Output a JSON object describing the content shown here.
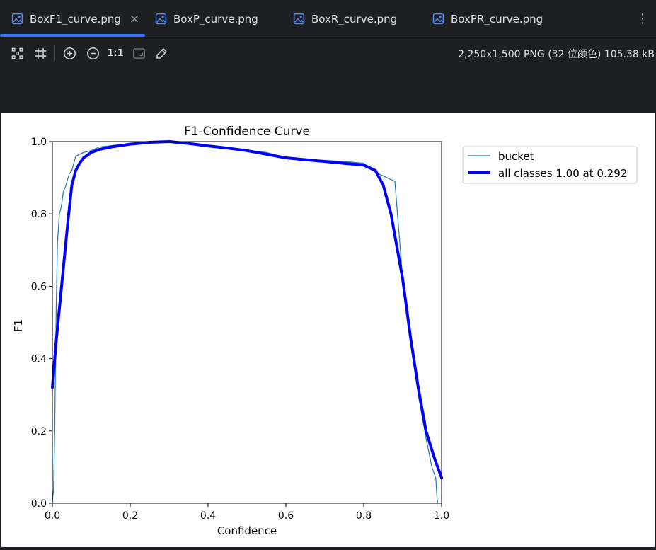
{
  "tabs": [
    {
      "label": "BoxF1_curve.png",
      "active": true
    },
    {
      "label": "BoxP_curve.png",
      "active": false
    },
    {
      "label": "BoxR_curve.png",
      "active": false
    },
    {
      "label": "BoxPR_curve.png",
      "active": false
    }
  ],
  "toolbar": {
    "one_to_one_label": "1:1",
    "image_info": "2,250x1,500 PNG (32 位颜色) 105.38 kB"
  },
  "colors": {
    "accent": "#3574f0",
    "bucket_series": "#1f77b4",
    "all_classes_series": "#0000ff"
  },
  "chart_data": {
    "type": "line",
    "title": "F1-Confidence Curve",
    "xlabel": "Confidence",
    "ylabel": "F1",
    "xlim": [
      0,
      1
    ],
    "ylim": [
      0,
      1
    ],
    "xticks": [
      "0.0",
      "0.2",
      "0.4",
      "0.6",
      "0.8",
      "1.0"
    ],
    "yticks": [
      "0.0",
      "0.2",
      "0.4",
      "0.6",
      "0.8",
      "1.0"
    ],
    "grid": false,
    "legend_position": "outside-right",
    "series": [
      {
        "name": "bucket",
        "x": [
          0.0,
          0.003,
          0.006,
          0.01,
          0.013,
          0.018,
          0.023,
          0.028,
          0.035,
          0.043,
          0.05,
          0.06,
          0.07,
          0.08,
          0.1,
          0.12,
          0.16,
          0.2,
          0.3,
          0.4,
          0.5,
          0.55,
          0.6,
          0.65,
          0.7,
          0.75,
          0.8,
          0.83,
          0.86,
          0.88,
          0.9,
          0.92,
          0.94,
          0.96,
          0.975,
          0.985,
          0.988,
          0.99
        ],
        "y": [
          0.0,
          0.04,
          0.2,
          0.55,
          0.72,
          0.8,
          0.82,
          0.86,
          0.88,
          0.91,
          0.92,
          0.96,
          0.965,
          0.97,
          0.975,
          0.985,
          0.99,
          0.995,
          0.998,
          0.99,
          0.975,
          0.97,
          0.955,
          0.95,
          0.948,
          0.945,
          0.94,
          0.915,
          0.9,
          0.89,
          0.62,
          0.45,
          0.3,
          0.18,
          0.1,
          0.07,
          0.02,
          0.0
        ]
      },
      {
        "name": "all classes 1.00 at 0.292",
        "x": [
          0.0,
          0.01,
          0.02,
          0.03,
          0.04,
          0.05,
          0.06,
          0.07,
          0.08,
          0.1,
          0.12,
          0.15,
          0.2,
          0.25,
          0.3,
          0.35,
          0.4,
          0.45,
          0.5,
          0.55,
          0.6,
          0.65,
          0.7,
          0.75,
          0.8,
          0.83,
          0.85,
          0.87,
          0.9,
          0.92,
          0.94,
          0.96,
          0.98,
          1.0
        ],
        "y": [
          0.32,
          0.45,
          0.56,
          0.67,
          0.78,
          0.88,
          0.92,
          0.94,
          0.955,
          0.97,
          0.978,
          0.985,
          0.993,
          0.998,
          1.0,
          0.995,
          0.988,
          0.982,
          0.975,
          0.965,
          0.955,
          0.95,
          0.945,
          0.94,
          0.935,
          0.92,
          0.88,
          0.8,
          0.62,
          0.46,
          0.32,
          0.2,
          0.13,
          0.07
        ]
      }
    ]
  }
}
